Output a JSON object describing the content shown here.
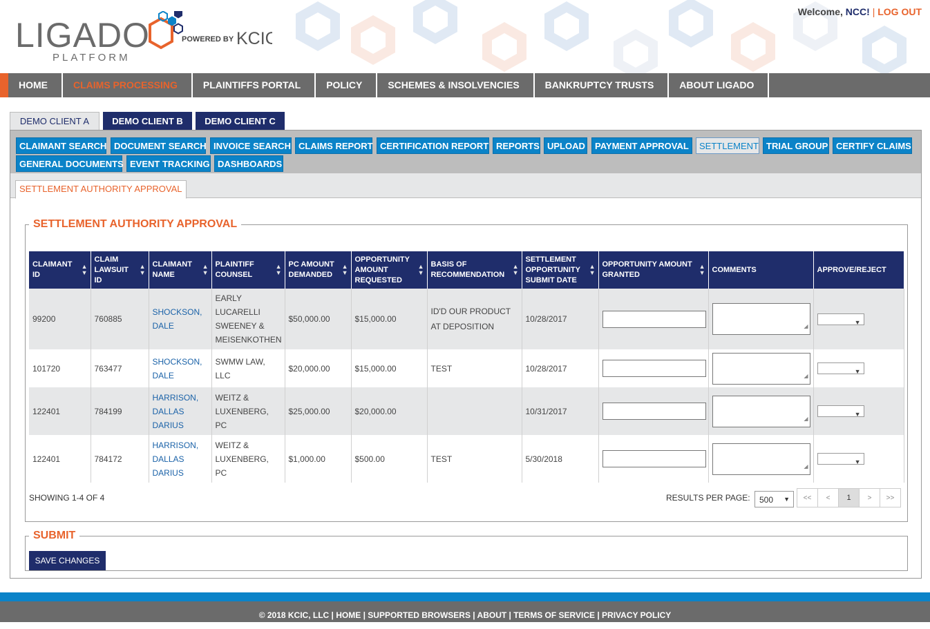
{
  "header": {
    "logo_text": "LIGADO",
    "logo_sub": "PLATFORM",
    "powered_by": "POWERED BY",
    "powered_brand": "KCIC",
    "welcome_prefix": "Welcome, ",
    "user": "NCC!",
    "separator": "|",
    "logout": "LOG OUT"
  },
  "main_nav": [
    "HOME",
    "CLAIMS PROCESSING",
    "PLAINTIFFS PORTAL",
    "POLICY",
    "SCHEMES & INSOLVENCIES",
    "BANKRUPTCY TRUSTS",
    "ABOUT LIGADO"
  ],
  "main_nav_active": "CLAIMS PROCESSING",
  "client_tabs": [
    "DEMO CLIENT A",
    "DEMO CLIENT B",
    "DEMO CLIENT C"
  ],
  "client_active": "DEMO CLIENT A",
  "sub_nav": [
    "CLAIMANT SEARCH",
    "DOCUMENT SEARCH",
    "INVOICE SEARCH",
    "CLAIMS REPORT",
    "CERTIFICATION REPORT",
    "REPORTS",
    "UPLOAD",
    "PAYMENT APPROVAL",
    "SETTLEMENT",
    "TRIAL GROUP",
    "CERTIFY CLAIMS",
    "GENERAL DOCUMENTS",
    "EVENT TRACKING",
    "DASHBOARDS"
  ],
  "sub_nav_active": "SETTLEMENT",
  "sub_tab": "SETTLEMENT AUTHORITY APPROVAL",
  "section_title": "SETTLEMENT AUTHORITY APPROVAL",
  "table": {
    "columns": [
      "CLAIMANT ID",
      "CLAIM LAWSUIT ID",
      "CLAIMANT NAME",
      "PLAINTIFF COUNSEL",
      "PC AMOUNT DEMANDED",
      "OPPORTUNITY AMOUNT REQUESTED",
      "BASIS OF RECOMMENDATION",
      "SETTLEMENT OPPORTUNITY SUBMIT DATE",
      "OPPORTUNITY AMOUNT GRANTED",
      "COMMENTS",
      "APPROVE/REJECT"
    ],
    "rows": [
      {
        "claimant_id": "99200",
        "lawsuit_id": "760885",
        "name": "SHOCKSON, DALE",
        "counsel": "EARLY LUCARELLI SWEENEY & MEISENKOTHEN",
        "pc_amount": "$50,000.00",
        "opp_requested": "$15,000.00",
        "basis": "ID'D OUR PRODUCT AT DEPOSITION",
        "submit_date": "10/28/2017"
      },
      {
        "claimant_id": "101720",
        "lawsuit_id": "763477",
        "name": "SHOCKSON, DALE",
        "counsel": "SWMW LAW, LLC",
        "pc_amount": "$20,000.00",
        "opp_requested": "$15,000.00",
        "basis": "TEST",
        "submit_date": "10/28/2017"
      },
      {
        "claimant_id": "122401",
        "lawsuit_id": "784199",
        "name": "HARRISON, DALLAS DARIUS",
        "counsel": "WEITZ & LUXENBERG, PC",
        "pc_amount": "$25,000.00",
        "opp_requested": "$20,000.00",
        "basis": "",
        "submit_date": "10/31/2017"
      },
      {
        "claimant_id": "122401",
        "lawsuit_id": "784172",
        "name": "HARRISON, DALLAS DARIUS",
        "counsel": "WEITZ & LUXENBERG, PC",
        "pc_amount": "$1,000.00",
        "opp_requested": "$500.00",
        "basis": "TEST",
        "submit_date": "5/30/2018"
      }
    ]
  },
  "showing": "SHOWING 1-4 OF 4",
  "results_per_page_label": "RESULTS PER PAGE:",
  "results_per_page_value": "500",
  "pager": [
    "<<",
    "<",
    "1",
    ">",
    ">>"
  ],
  "pager_current": "1",
  "submit_title": "SUBMIT",
  "save_button": "SAVE CHANGES",
  "footer": "© 2018 KCIC, LLC | HOME | SUPPORTED BROWSERS | ABOUT | TERMS OF SERVICE | PRIVACY POLICY",
  "colors": {
    "navy": "#1f2d6b",
    "orange": "#e8632c",
    "blue": "#0b83c8",
    "gray": "#6b6b6b"
  }
}
